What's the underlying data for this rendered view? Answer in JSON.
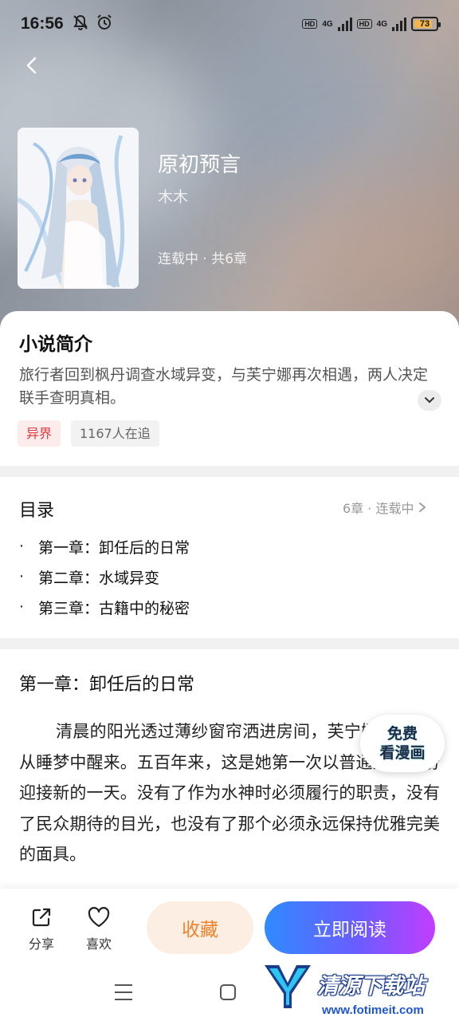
{
  "status_bar": {
    "time": "16:56",
    "net1": "4G",
    "net2": "4G",
    "battery": "73"
  },
  "book": {
    "title": "原初预言",
    "author": "木木",
    "status": "连载中 · 共6章"
  },
  "intro": {
    "heading": "小说简介",
    "text": "旅行者回到枫丹调查水域异变，与芙宁娜再次相遇，两人决定联手查明真相。",
    "tags": [
      "异界",
      "1167人在追"
    ]
  },
  "toc": {
    "heading": "目录",
    "meta": "6章 · 连载中",
    "chapters": [
      "第一章：卸任后的日常",
      "第二章：水域异变",
      "第三章：古籍中的秘密"
    ]
  },
  "chapter": {
    "title": "第一章：卸任后的日常",
    "body": "清晨的阳光透过薄纱窗帘洒进房间，芙宁娜·德·枫丹从睡梦中醒来。五百年来，这是她第一次以普通人的身份迎接新的一天。没有了作为水神时必须履行的职责，没有了民众期待的目光，也没有了那个必须永远保持优雅完美的面具。"
  },
  "float_badge": {
    "line1": "免费",
    "line2": "看漫画"
  },
  "bottom_bar": {
    "share_label": "分享",
    "like_label": "喜欢",
    "favorite_label": "收藏",
    "read_label": "立即阅读"
  },
  "watermark": {
    "name": "清源下载站",
    "url": "www.fotimeit.com"
  },
  "colors": {
    "accent_orange": "#f0822a",
    "tag_red": "#e0383e",
    "read_gradient_start": "#2f8bff",
    "read_gradient_end": "#c23dff"
  }
}
